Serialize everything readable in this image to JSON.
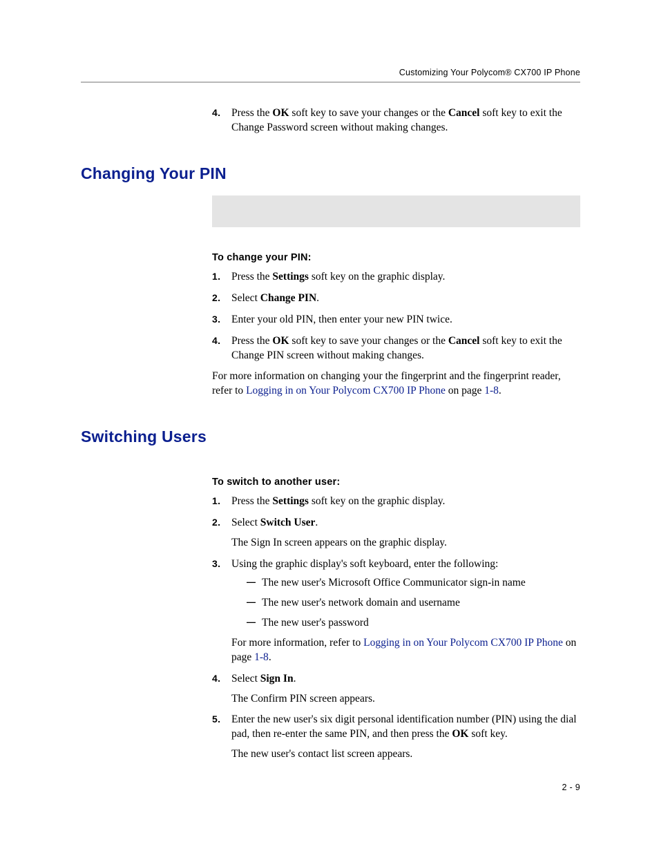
{
  "header": {
    "running_title": "Customizing Your Polycom® CX700 IP Phone"
  },
  "intro_step4": {
    "num": "4.",
    "t1": "Press the ",
    "b1": "OK",
    "t2": " soft key to save your changes or the ",
    "b2": "Cancel",
    "t3": " soft key to exit the Change Password screen without making changes."
  },
  "section_pin": {
    "heading": "Changing Your PIN",
    "subhead": "To change your PIN:",
    "steps": {
      "s1": {
        "num": "1.",
        "t1": "Press the ",
        "b1": "Settings",
        "t2": " soft key on the graphic display."
      },
      "s2": {
        "num": "2.",
        "t1": "Select ",
        "b1": "Change PIN",
        "t2": "."
      },
      "s3": {
        "num": "3.",
        "t1": "Enter your old PIN, then enter your new PIN twice."
      },
      "s4": {
        "num": "4.",
        "t1": "Press the ",
        "b1": "OK",
        "t2": " soft key to save your changes or the ",
        "b2": "Cancel",
        "t3": " soft key to exit the Change PIN screen without making changes."
      }
    },
    "after": {
      "t1": "For more information on changing your the fingerprint and the fingerprint reader, refer to ",
      "link1": "Logging in on Your Polycom CX700 IP Phone",
      "t2": " on page ",
      "link2": "1-8",
      "t3": "."
    }
  },
  "section_switch": {
    "heading": "Switching Users",
    "subhead": "To switch to another user:",
    "steps": {
      "s1": {
        "num": "1.",
        "t1": "Press the ",
        "b1": "Settings",
        "t2": " soft key on the graphic display."
      },
      "s2": {
        "num": "2.",
        "t1": "Select ",
        "b1": "Switch User",
        "t2": ".",
        "follow": "The Sign In screen appears on the graphic display."
      },
      "s3": {
        "num": "3.",
        "t1": "Using the graphic display's soft keyboard, enter the following:",
        "bullets": [
          "The new user's Microsoft Office Communicator sign-in name",
          "The new user's network domain and username",
          "The new user's password"
        ],
        "after_t1": "For more information, refer to ",
        "after_link1": "Logging in on Your Polycom CX700 IP Phone",
        "after_t2": " on page ",
        "after_link2": "1-8",
        "after_t3": "."
      },
      "s4": {
        "num": "4.",
        "t1": "Select ",
        "b1": "Sign In",
        "t2": ".",
        "follow": "The Confirm PIN screen appears."
      },
      "s5": {
        "num": "5.",
        "t1": "Enter the new user's six digit personal identification number (PIN) using the dial pad, then re-enter the same PIN, and then press the ",
        "b1": "OK",
        "t2": " soft key.",
        "follow": "The new user's contact list screen appears."
      }
    }
  },
  "footer": {
    "page": "2 - 9"
  }
}
